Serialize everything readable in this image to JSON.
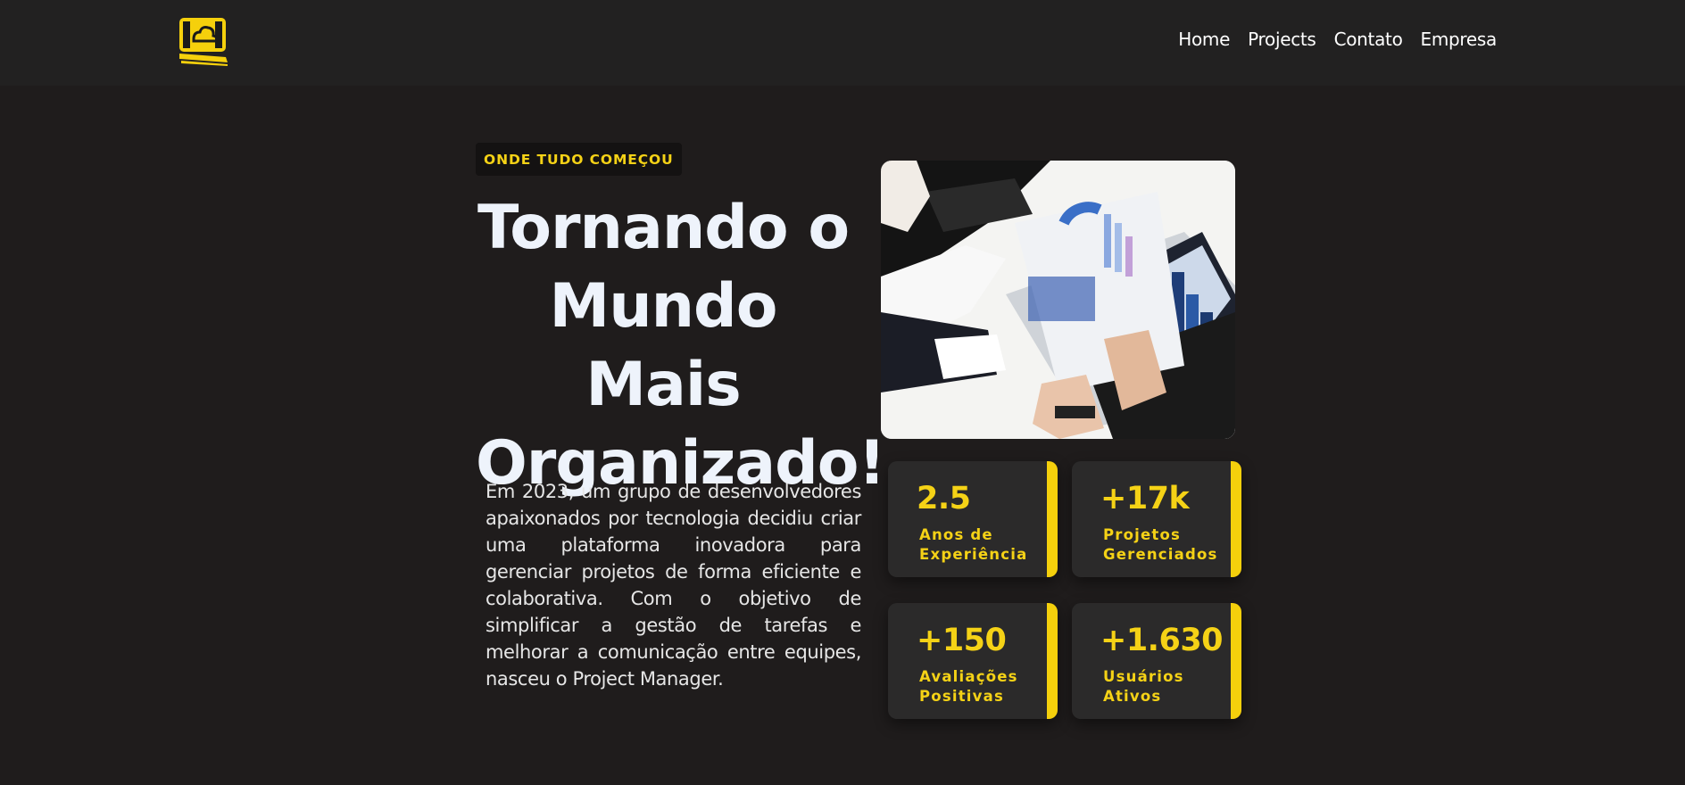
{
  "header": {
    "logo_icon": "cloud-wallet-icon",
    "nav": [
      {
        "label": "Home"
      },
      {
        "label": "Projects"
      },
      {
        "label": "Contato"
      },
      {
        "label": "Empresa"
      }
    ]
  },
  "hero": {
    "badge": "ONDE TUDO COMEÇOU",
    "title": "Tornando o Mundo Mais Organizado!",
    "story": "Em 2023, um grupo de desenvolvedores apaixonados por tecnologia decidiu criar uma plataforma inovadora para gerenciar projetos de forma eficiente e colaborativa. Com o objetivo de simplificar a gestão de tarefas e melhorar a comunicação entre equipes, nasceu o Project Manager."
  },
  "stats": [
    {
      "value": "2.5",
      "label": "Anos de Experiência"
    },
    {
      "value": "+17k",
      "label": "Projetos Gerenciados"
    },
    {
      "value": "+150",
      "label": "Avaliações Positivas"
    },
    {
      "value": "+1.630",
      "label": "Usuários Ativos"
    }
  ],
  "colors": {
    "background": "#1f1c1c",
    "header": "#222121",
    "accent": "#f5d216",
    "card": "#2b2a2a"
  }
}
